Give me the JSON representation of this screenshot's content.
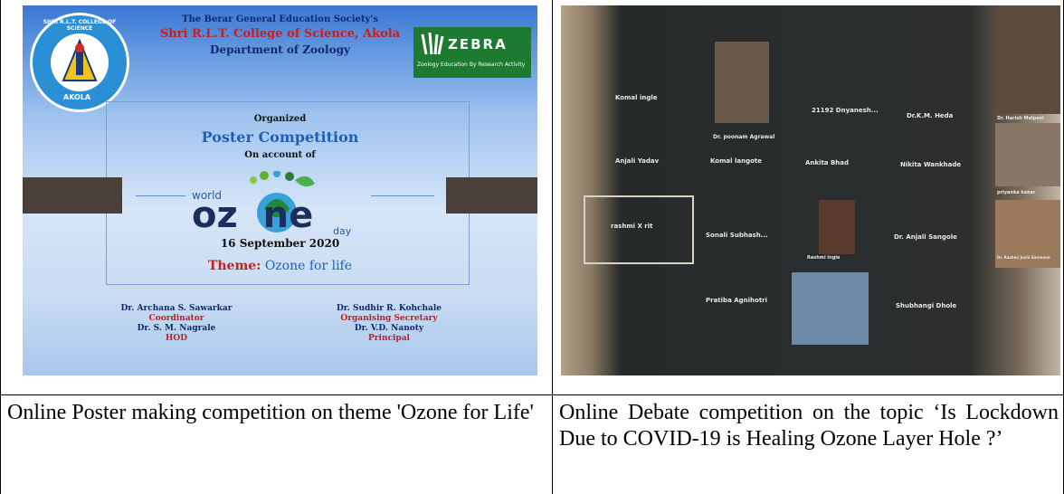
{
  "poster": {
    "society": "The Berar General Education Society's",
    "college": "Shri R.L.T. College of Science, Akola",
    "department": "Department of Zoology",
    "logo_arc_text": "SHRI R.L.T. COLLEGE OF SCIENCE",
    "logo_bottom_text": "AKOLA",
    "zebra_title": "ZEBRA",
    "zebra_subtitle": "Zoology Education By Research Activity",
    "organized": "Organized",
    "event": "Poster Competition",
    "on_account": "On account of",
    "ozone_word_top": "world",
    "ozone_word_main": "oz  ne",
    "ozone_word_bottom": "day",
    "date": "16 September 2020",
    "theme_label": "Theme:",
    "theme_value": "Ozone for life",
    "people": [
      {
        "name": "Dr. Archana S. Sawarkar",
        "role": "Coordinator"
      },
      {
        "name": "Dr. Sudhir R. Kohchale",
        "role": "Organising Secretary"
      },
      {
        "name": "Dr. S. M. Nagrale",
        "role": "HOD"
      },
      {
        "name": "Dr. V.D. Nanoty",
        "role": "Principal"
      }
    ]
  },
  "zoom": {
    "participants": [
      "Komal ingle",
      "Dr. poonam Agrawal",
      "21192 Dnyanesh...",
      "Dr.K.M. Heda",
      "Dr. Harish Malpani",
      "Anjali Yadav",
      "Komal langote",
      "Ankita Bhad",
      "Nikita Wankhade",
      "priyanka kakar",
      "rashmi X rit",
      "Sonali Subhash...",
      "Rashmi ingle",
      "Dr. Anjali Sangole",
      "Dr. Rashmi Joshi Sanmane",
      "Pratiba Agnihotri",
      "Shubhangi Dhole"
    ]
  },
  "captions": {
    "left": "Online Poster making competition on theme 'Ozone for Life'",
    "right": "Online Debate competition on the topic ‘Is Lockdown Due to COVID-19 is Healing Ozone Layer Hole ?’"
  },
  "colors": {
    "border": "#000000",
    "poster_blue": "#3a78d4",
    "red_text": "#c81e1e",
    "navy_text": "#0f2a6b"
  }
}
